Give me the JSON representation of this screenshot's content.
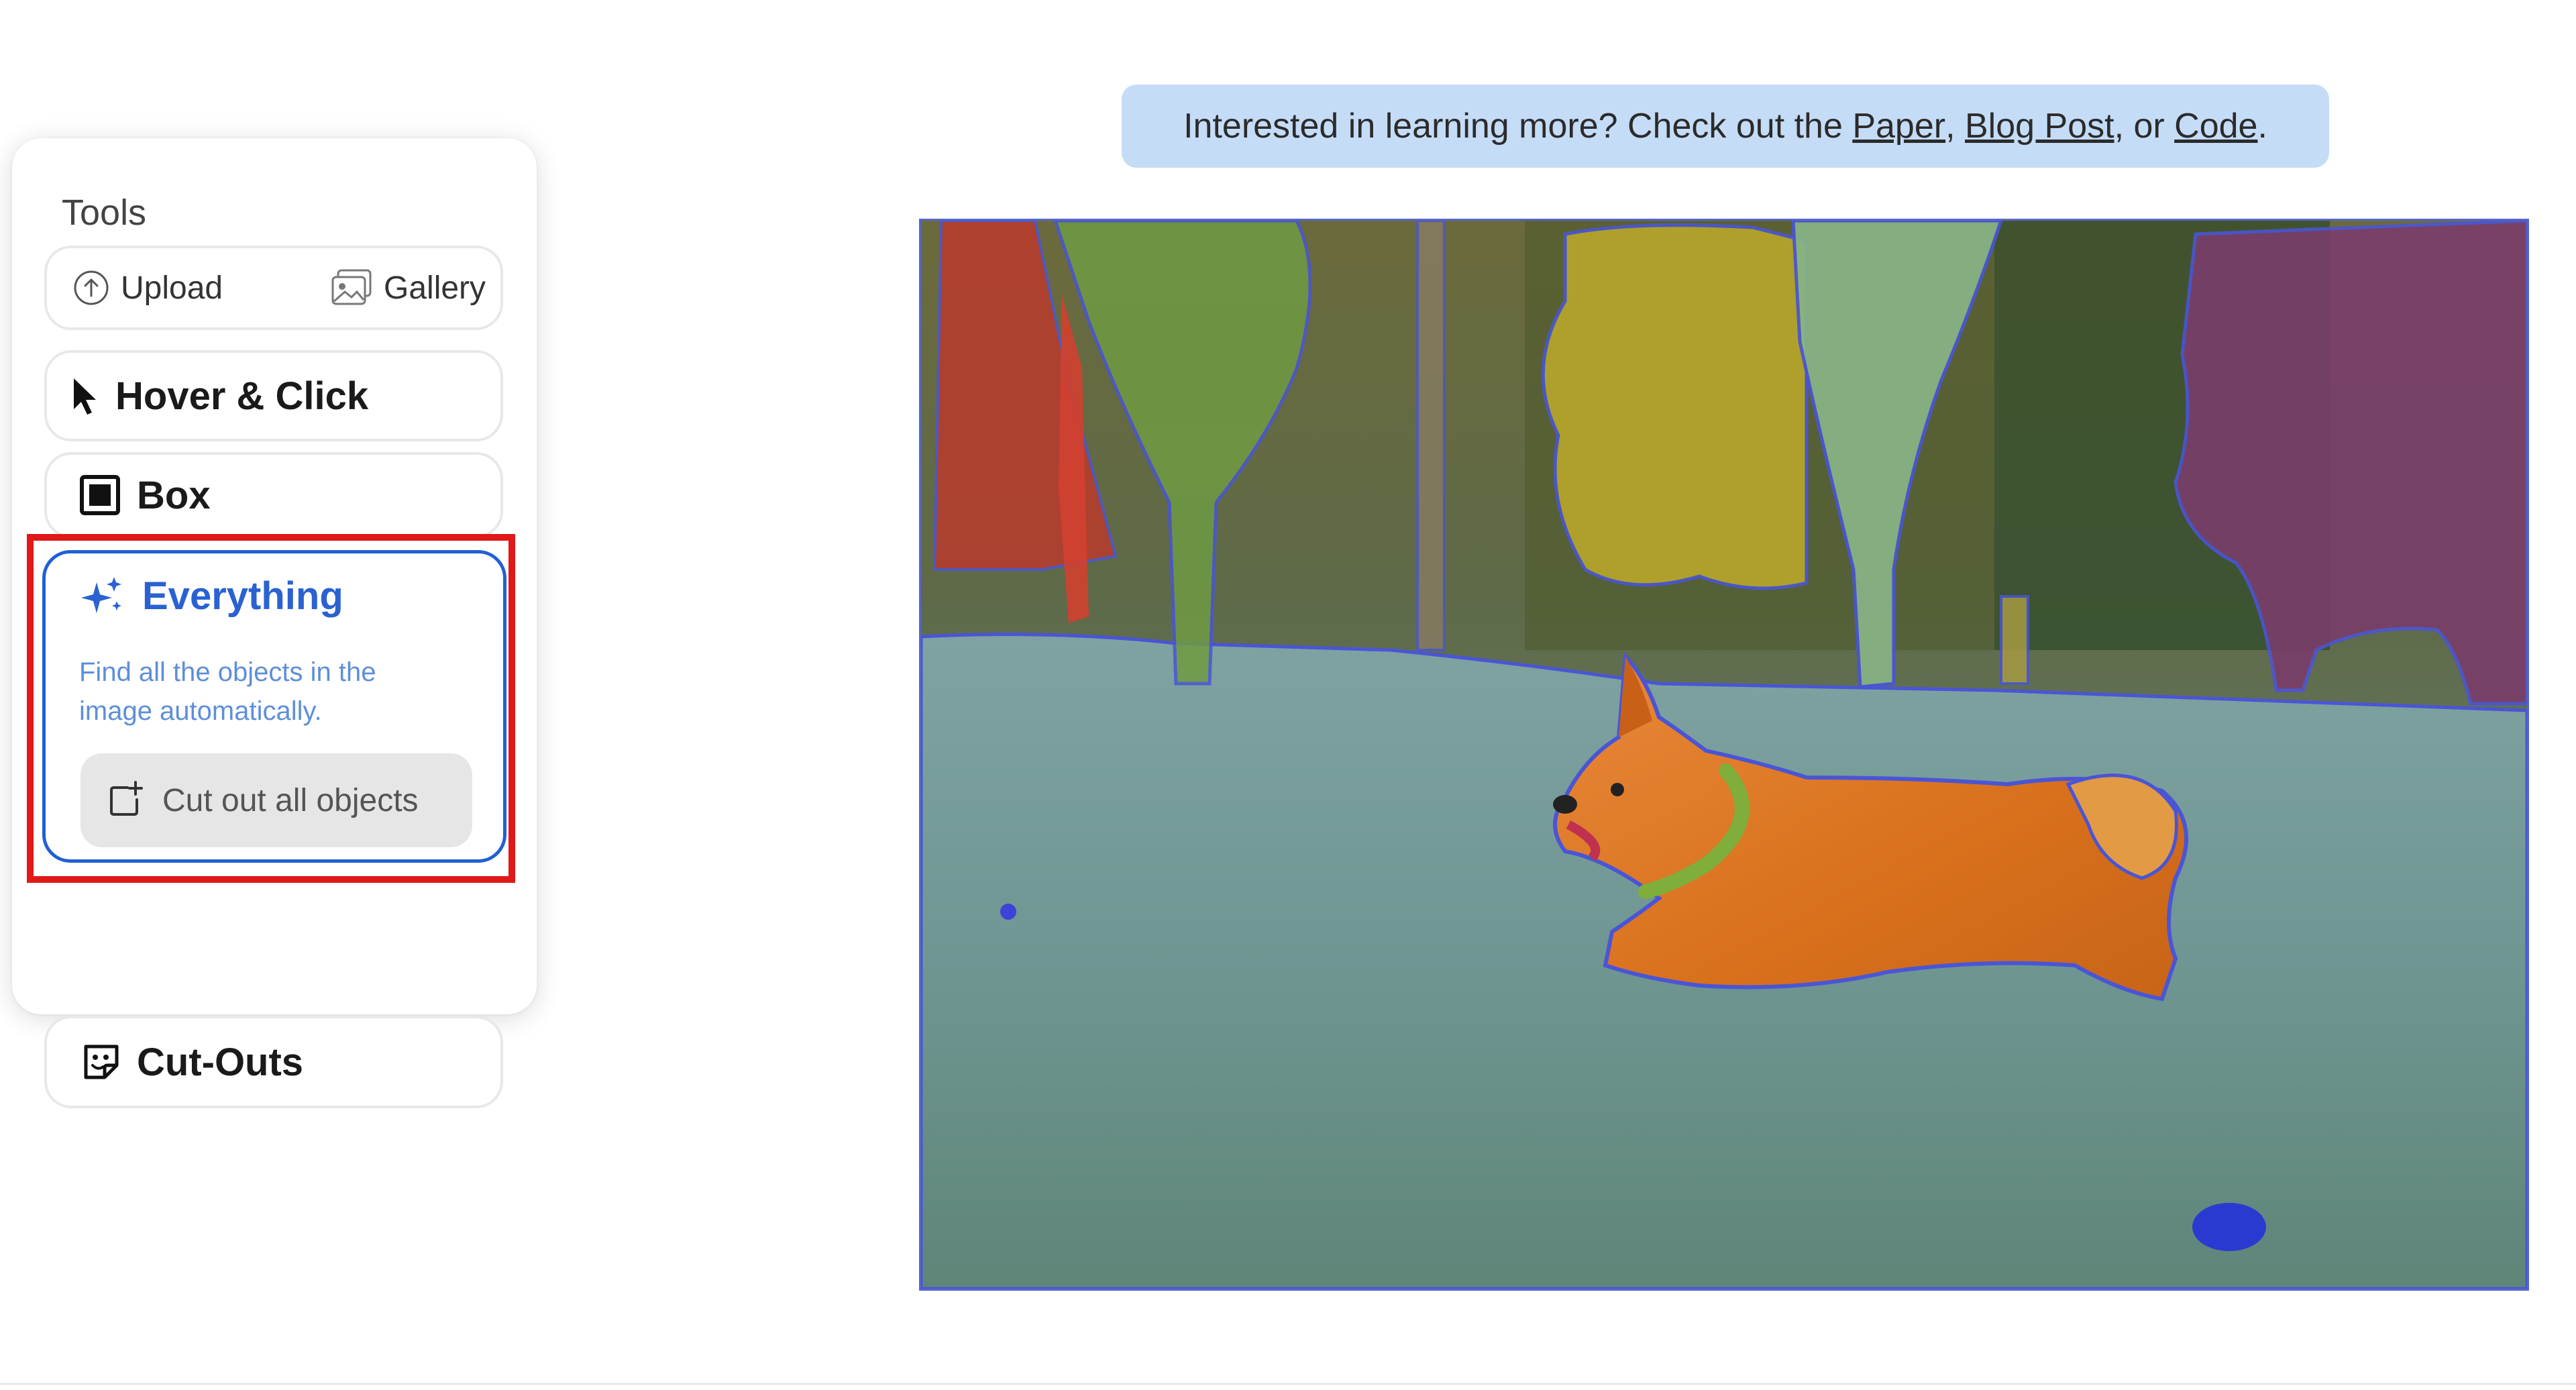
{
  "tools": {
    "title": "Tools",
    "upload_label": "Upload",
    "gallery_label": "Gallery",
    "items": [
      {
        "label": "Hover & Click",
        "icon": "cursor-icon"
      },
      {
        "label": "Box",
        "icon": "box-icon"
      },
      {
        "label": "Everything",
        "icon": "sparkles-icon",
        "selected": true,
        "description": "Find all the objects in the image automatically.",
        "action_label": "Cut out all objects"
      },
      {
        "label": "Cut-Outs",
        "icon": "cutouts-icon"
      }
    ]
  },
  "banner": {
    "prefix": "Interested in learning more? Check out the ",
    "links": [
      "Paper",
      "Blog Post",
      "Code"
    ],
    "sep1": ", ",
    "sep2": ", or ",
    "suffix": "."
  },
  "colors": {
    "accent": "#2160d4",
    "highlight": "#e01818",
    "banner_bg": "#c5dcf7",
    "mask_outline": "#4a55d6"
  }
}
